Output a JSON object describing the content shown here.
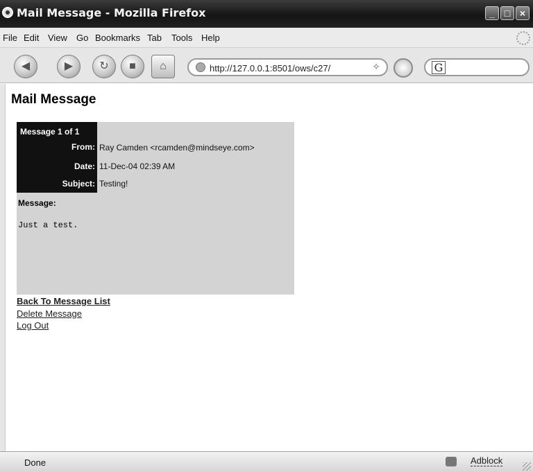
{
  "window": {
    "title": "Mail Message - Mozilla Firefox",
    "controls": {
      "minimize": "_",
      "maximize": "□",
      "close": "×"
    }
  },
  "menubar": {
    "items": [
      "File",
      "Edit",
      "View",
      "Go",
      "Bookmarks",
      "Tab",
      "Tools",
      "Help"
    ]
  },
  "navigation": {
    "url": "http://127.0.0.1:8501/ows/c27/",
    "search_engine_glyph": "G",
    "search_value": "",
    "icons": [
      "back-icon",
      "forward-icon",
      "reload-icon",
      "stop-icon",
      "home-icon",
      "globe-icon",
      "bookmark-icon",
      "go-icon",
      "search-engine-icon",
      "throbber-icon"
    ]
  },
  "page": {
    "title": "Mail Message",
    "message": {
      "header": "Message 1 of 1",
      "from_label": "From:",
      "from_value": "Ray Camden <rcamden@mindseye.com>",
      "date_label": "Date:",
      "date_value": "11-Dec-04 02:39 AM",
      "subject_label": "Subject:",
      "subject_value": "Testing!",
      "body_label": "Message:",
      "body": "Just a test."
    },
    "links": {
      "back": "Back To Message List",
      "delete": "Delete Message",
      "logout": "Log Out"
    }
  },
  "statusbar": {
    "status": "Done",
    "addon": "Adblock"
  },
  "colors": {
    "title_bar": "#1e1e1e",
    "message_bg": "#d3d3d3",
    "label_bg": "#111111"
  }
}
